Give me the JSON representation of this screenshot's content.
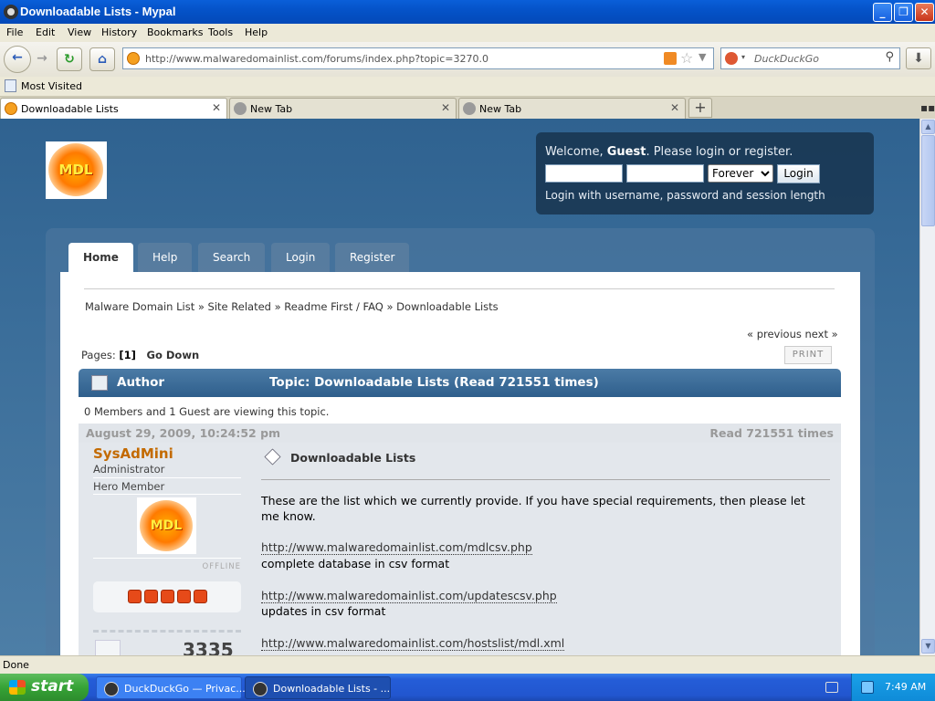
{
  "window": {
    "title": "Downloadable Lists - Mypal"
  },
  "menu": [
    "File",
    "Edit",
    "View",
    "History",
    "Bookmarks",
    "Tools",
    "Help"
  ],
  "toolbar": {
    "url": "http://www.malwaredomainlist.com/forums/index.php?topic=3270.0",
    "search_placeholder": "DuckDuckGo"
  },
  "bookmarks": {
    "most_visited": "Most Visited"
  },
  "tabs": [
    {
      "label": "Downloadable Lists",
      "active": true
    },
    {
      "label": "New Tab",
      "active": false
    },
    {
      "label": "New Tab",
      "active": false
    }
  ],
  "page": {
    "logo_text": "MDL",
    "welcome_prefix": "Welcome,",
    "guest": "Guest",
    "welcome_suffix": ". Please login or register.",
    "session_option": "Forever",
    "login_button": "Login",
    "login_hint": "Login with username, password and session length",
    "nav": [
      "Home",
      "Help",
      "Search",
      "Login",
      "Register"
    ],
    "breadcrumb": "Malware Domain List » Site Related » Readme First / FAQ » Downloadable Lists",
    "prevnext": "« previous next »",
    "pages_label": "Pages:",
    "pages_current": "[1]",
    "go_down": "Go Down",
    "print": "PRINT",
    "cat_author": "Author",
    "cat_topic": "Topic: Downloadable Lists  (Read 721551 times)",
    "viewing": "0 Members and 1 Guest are viewing this topic.",
    "post_date": "August 29, 2009, 10:24:52 pm",
    "post_read": "Read 721551 times",
    "poster": {
      "name": "SysAdMini",
      "role": "Administrator",
      "rank": "Hero Member",
      "status": "OFFLINE",
      "stars": 5,
      "post_count": "3335"
    },
    "subject": "Downloadable Lists",
    "body_intro": "These are the list which we currently provide. If you have special requirements, then please let me know.",
    "links": [
      {
        "url": "http://www.malwaredomainlist.com/mdlcsv.php",
        "desc": "complete database in csv format"
      },
      {
        "url": "http://www.malwaredomainlist.com/updatescsv.php",
        "desc": "updates in csv format"
      },
      {
        "url": "http://www.malwaredomainlist.com/hostslist/mdl.xml",
        "desc": ""
      }
    ]
  },
  "status": "Done",
  "taskbar": {
    "start": "start",
    "tasks": [
      "DuckDuckGo — Privac...",
      "Downloadable Lists - ..."
    ],
    "clock": "7:49 AM"
  },
  "colors": {
    "page_bg": "#3b6e9a",
    "poster_name": "#c36a00",
    "star": "#e64a19"
  }
}
